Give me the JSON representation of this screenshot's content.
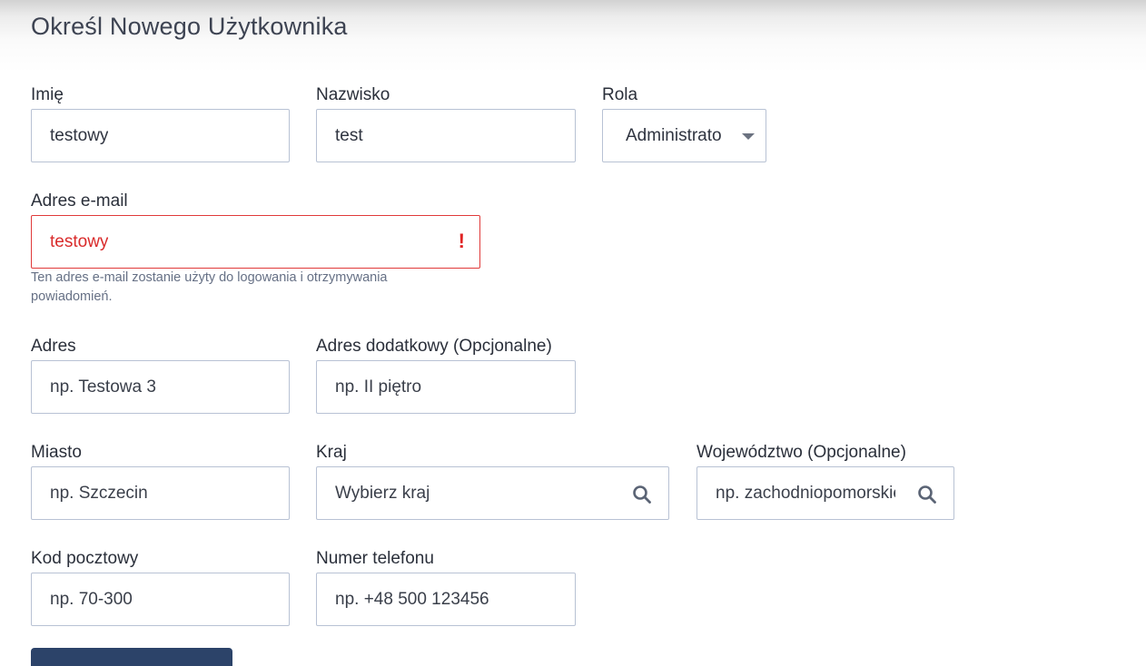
{
  "page": {
    "title": "Określ Nowego Użytkownika"
  },
  "form": {
    "first_name": {
      "label": "Imię",
      "value": "testowy"
    },
    "last_name": {
      "label": "Nazwisko",
      "value": "test"
    },
    "role": {
      "label": "Rola",
      "value": "Administrato"
    },
    "email": {
      "label": "Adres e-mail",
      "value": "testowy",
      "error_mark": "!",
      "helper": "Ten adres e-mail zostanie użyty do logowania i otrzymywania powiadomień.",
      "state": "error"
    },
    "address": {
      "label": "Adres",
      "placeholder": "np. Testowa 3"
    },
    "address_extra": {
      "label": "Adres dodatkowy (Opcjonalne)",
      "placeholder": "np. II piętro"
    },
    "city": {
      "label": "Miasto",
      "placeholder": "np. Szczecin"
    },
    "country": {
      "label": "Kraj",
      "placeholder": "Wybierz kraj",
      "icon": "search-icon"
    },
    "province": {
      "label": "Województwo (Opcjonalne)",
      "placeholder": "np. zachodniopomorskie",
      "icon": "search-icon"
    },
    "postal_code": {
      "label": "Kod pocztowy",
      "placeholder": "np. 70-300"
    },
    "phone": {
      "label": "Numer telefonu",
      "placeholder": "np. +48 500 123456"
    }
  },
  "colors": {
    "error": "#e02424",
    "border": "#b8c2d4",
    "primary_button": "#2c4369"
  }
}
